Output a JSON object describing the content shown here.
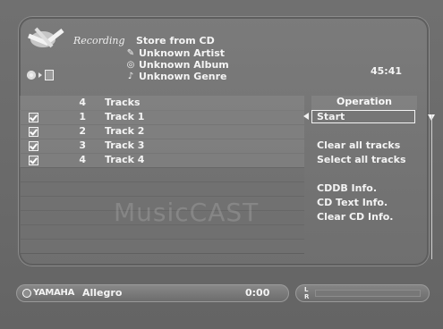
{
  "header": {
    "mode": "Recording",
    "store_title": "Store from CD",
    "artist": "Unknown Artist",
    "album": "Unknown Album",
    "genre": "Unknown Genre",
    "time": "45:41"
  },
  "tracklist": {
    "count": "4",
    "header_label": "Tracks",
    "items": [
      {
        "num": "1",
        "title": "Track 1",
        "checked": true
      },
      {
        "num": "2",
        "title": "Track 2",
        "checked": true
      },
      {
        "num": "3",
        "title": "Track 3",
        "checked": true
      },
      {
        "num": "4",
        "title": "Track 4",
        "checked": true
      }
    ]
  },
  "operations": {
    "header": "Operation",
    "items": [
      "Start",
      "Clear all tracks",
      "Select all tracks",
      "CDDB Info.",
      "CD Text Info.",
      "Clear CD Info."
    ]
  },
  "watermark": "MusicCAST",
  "footer": {
    "brand": "YAMAHA",
    "station": "Allegro",
    "elapsed": "0:00",
    "meter_left": "L",
    "meter_right": "R"
  },
  "icons": [
    "recording-logo-icon",
    "disc-icon",
    "arrow-icon",
    "box-icon",
    "pencil-icon",
    "disc-icon",
    "guitar-icon",
    "checkbox-icon",
    "left-pointer-icon",
    "scroll-down-icon",
    "yamaha-emblem-icon"
  ],
  "colors": {
    "background": "#6e6e6e",
    "text": "#f4f4f4"
  }
}
